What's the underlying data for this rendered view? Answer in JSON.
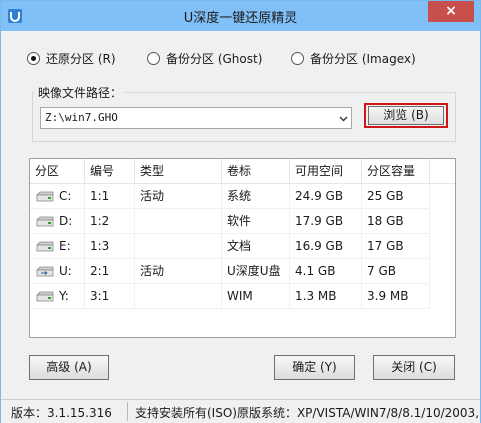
{
  "window": {
    "title": "U深度一键还原精灵",
    "close_label": "×"
  },
  "modes": [
    {
      "label": "还原分区 (R)",
      "checked": true
    },
    {
      "label": "备份分区 (Ghost)",
      "checked": false
    },
    {
      "label": "备份分区 (Imagex)",
      "checked": false
    }
  ],
  "image_path": {
    "caption": "映像文件路径：",
    "value": "Z:\\win7.GHO",
    "browse_label": "浏览 (B)"
  },
  "table": {
    "headers": [
      "分区",
      "编号",
      "类型",
      "卷标",
      "可用空间",
      "分区容量"
    ],
    "rows": [
      {
        "drive": "C:",
        "number": "1:1",
        "type": "活动",
        "label": "系统",
        "free": "24.9 GB",
        "size": "25 GB",
        "usb": false
      },
      {
        "drive": "D:",
        "number": "1:2",
        "type": "",
        "label": "软件",
        "free": "17.9 GB",
        "size": "18 GB",
        "usb": false
      },
      {
        "drive": "E:",
        "number": "1:3",
        "type": "",
        "label": "文档",
        "free": "16.9 GB",
        "size": "17 GB",
        "usb": false
      },
      {
        "drive": "U:",
        "number": "2:1",
        "type": "活动",
        "label": "U深度U盘",
        "free": "4.1 GB",
        "size": "7 GB",
        "usb": true
      },
      {
        "drive": "Y:",
        "number": "3:1",
        "type": "",
        "label": "WIM",
        "free": "1.3 MB",
        "size": "3.9 MB",
        "usb": false
      }
    ]
  },
  "buttons": {
    "advanced": "高级 (A)",
    "ok": "确定 (Y)",
    "close": "关闭 (C)"
  },
  "status": {
    "version": "版本：3.1.15.316",
    "support": "支持安装所有(ISO)原版系统：XP/VISTA/WIN7/8/8.1/10/2003,"
  },
  "colors": {
    "titlebar": "#80c0f6",
    "close": "#c7504c",
    "highlight_border": "#d01717"
  }
}
